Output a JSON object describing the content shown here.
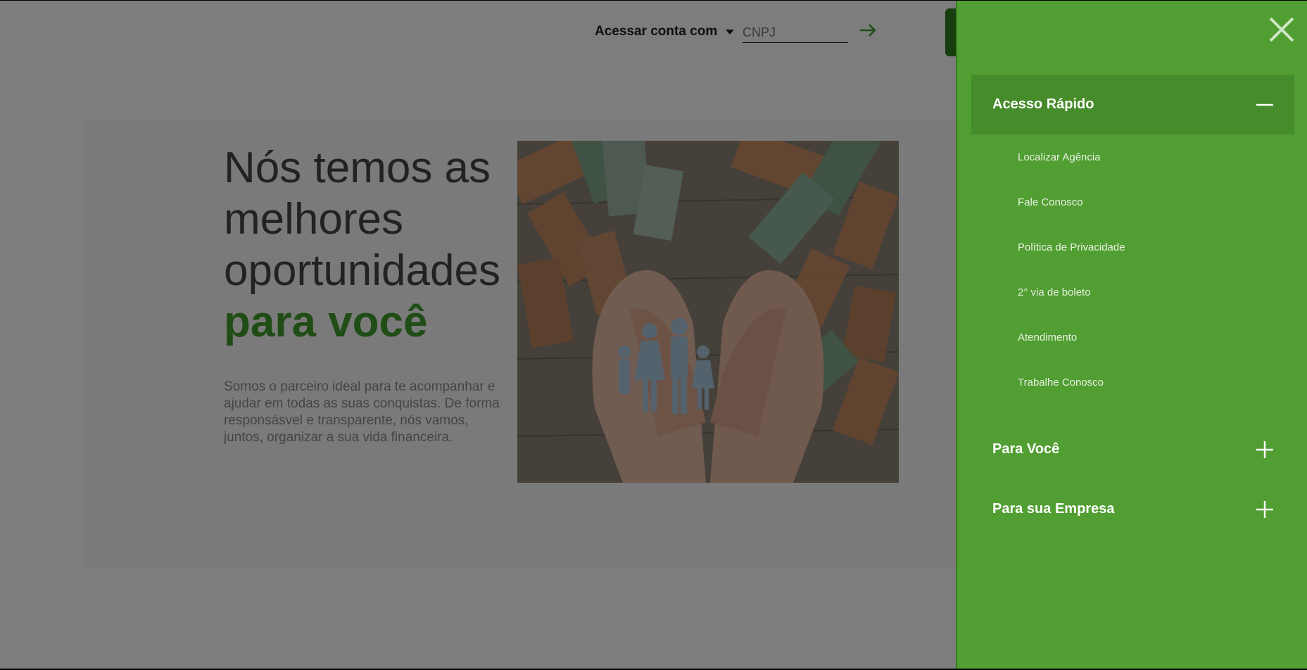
{
  "header": {
    "account_label": "Acessar conta com",
    "account_field": {
      "placeholder": "CNPJ",
      "value": ""
    }
  },
  "hero": {
    "headline_line1": "Nós temos as",
    "headline_line2": "melhores",
    "headline_line3": "oportunidades",
    "headline_accent": "para você",
    "lead": "Somos o parceiro ideal para te acompanhar e ajudar em todas as suas conquistas. De forma responsásvel e transparente, nós vamos, juntos, organizar a sua vida financeira."
  },
  "drawer": {
    "sections": [
      {
        "title": "Acesso Rápido",
        "expanded": true,
        "icon": "minus-icon",
        "items": [
          "Localizar Agência",
          "Fale Conosco",
          "Política de Privacidade",
          "2° via de boleto",
          "Atendimento",
          "Trabalhe Conosco"
        ]
      },
      {
        "title": "Para Você",
        "expanded": false,
        "icon": "plus-icon"
      },
      {
        "title": "Para sua Empresa",
        "expanded": false,
        "icon": "plus-icon"
      }
    ]
  },
  "colors": {
    "brand_green": "#519e32",
    "accent_green": "#3f9a2b",
    "drawer_header_active": "#468c2a",
    "overlay": "rgba(0,0,0,0.5)"
  }
}
